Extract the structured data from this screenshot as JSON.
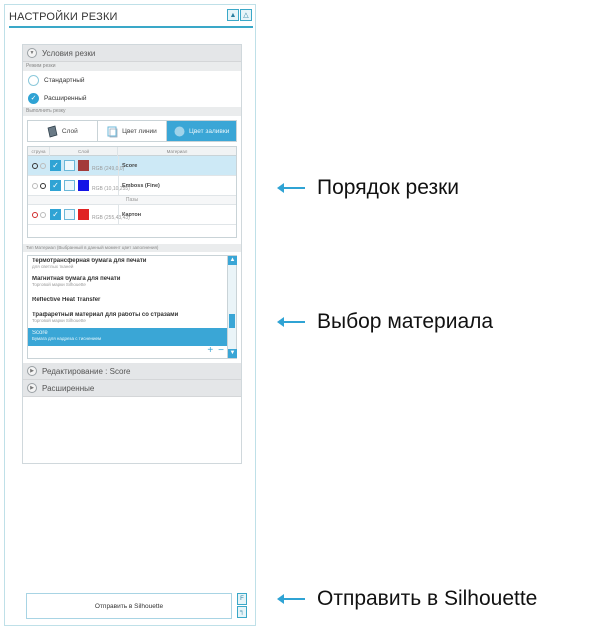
{
  "panel": {
    "title": "НАСТРОЙКИ РЕЗКИ",
    "title_btn_1": "▲",
    "title_btn_2": "△"
  },
  "cut_conditions": {
    "header": "Условия резки",
    "mode_label": "Режим резки",
    "mode_standard": "Стандартный",
    "mode_extended": "Расширенный",
    "selected_mode": "Расширенный",
    "cut_by_label": "Выполнить резку",
    "tabs": [
      "Слой",
      "Цвет линии",
      "Цвет заливки"
    ],
    "active_tab": "Цвет заливки"
  },
  "table": {
    "headers": [
      "струна",
      "Слой",
      "Материал"
    ],
    "rows": [
      {
        "rgb": "RGB (249,0,0)",
        "material": "Score",
        "color": "#a33a3a",
        "selected": true
      },
      {
        "rgb": "RGB (10,10,255)",
        "material": "Emboss (Fine)",
        "color": "#1414e6",
        "selected": false
      }
    ],
    "group_label": "Пазы",
    "rows2": [
      {
        "rgb": "RGB (255,43,43)",
        "material": "Картон",
        "color": "#e02222",
        "selected": false
      }
    ]
  },
  "materials": {
    "header": "Тип Материал (Выбранный в данный момент цвет заполнения)",
    "items": [
      {
        "name": "Термотрансферная бумага для печати",
        "sub": "для светлых тканей"
      },
      {
        "name": "Магнитная бумага для печати",
        "sub": "Торговой марки Silhouette"
      },
      {
        "name": "Reflective Heat Transfer",
        "sub": ""
      },
      {
        "name": "Трафаретный материал для работы со стразами",
        "sub": "Торговой марки Silhouette"
      },
      {
        "name": "Score",
        "sub": "Бумага для надреза с тиснением"
      }
    ],
    "selected": "Score",
    "add_label": "+",
    "remove_label": "−"
  },
  "collapsed_sections": {
    "edit": "Редактирование : Score",
    "advanced": "Расширенные"
  },
  "send_button": "Отправить в Silhouette",
  "side_btn_1": "F",
  "side_btn_2": "╕",
  "callouts": {
    "cut_order": "Порядок резки",
    "material_choice": "Выбор материала",
    "send": "Отправить в Silhouette"
  }
}
